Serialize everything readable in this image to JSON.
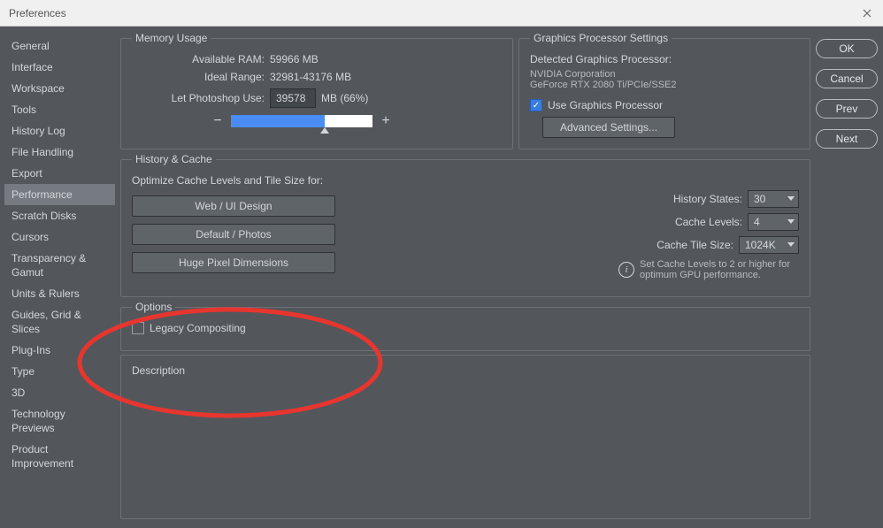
{
  "window": {
    "title": "Preferences"
  },
  "sidebar": {
    "items": [
      "General",
      "Interface",
      "Workspace",
      "Tools",
      "History Log",
      "File Handling",
      "Export",
      "Performance",
      "Scratch Disks",
      "Cursors",
      "Transparency & Gamut",
      "Units & Rulers",
      "Guides, Grid & Slices",
      "Plug-Ins",
      "Type",
      "3D",
      "Technology Previews",
      "Product Improvement"
    ],
    "selected_index": 7
  },
  "buttons": {
    "ok": "OK",
    "cancel": "Cancel",
    "prev": "Prev",
    "next": "Next"
  },
  "memory": {
    "legend": "Memory Usage",
    "available_label": "Available RAM:",
    "available_value": "59966 MB",
    "ideal_label": "Ideal Range:",
    "ideal_value": "32981-43176 MB",
    "use_label": "Let Photoshop Use:",
    "use_value": "39578",
    "use_suffix": "MB (66%)",
    "slider_percent": 66
  },
  "gpu": {
    "legend": "Graphics Processor Settings",
    "detected_label": "Detected Graphics Processor:",
    "vendor": "NVIDIA Corporation",
    "model": "GeForce RTX 2080 Ti/PCIe/SSE2",
    "use_gpu_label": "Use Graphics Processor",
    "use_gpu_checked": true,
    "advanced_btn": "Advanced Settings..."
  },
  "history": {
    "legend": "History & Cache",
    "optimize_label": "Optimize Cache Levels and Tile Size for:",
    "btn_web": "Web / UI Design",
    "btn_default": "Default / Photos",
    "btn_huge": "Huge Pixel Dimensions",
    "states_label": "History States:",
    "states_value": "30",
    "cache_label": "Cache Levels:",
    "cache_value": "4",
    "tile_label": "Cache Tile Size:",
    "tile_value": "1024K",
    "hint": "Set Cache Levels to 2 or higher for optimum GPU performance."
  },
  "options": {
    "legend": "Options",
    "legacy_label": "Legacy Compositing",
    "legacy_checked": false
  },
  "description": {
    "legend": "Description"
  }
}
